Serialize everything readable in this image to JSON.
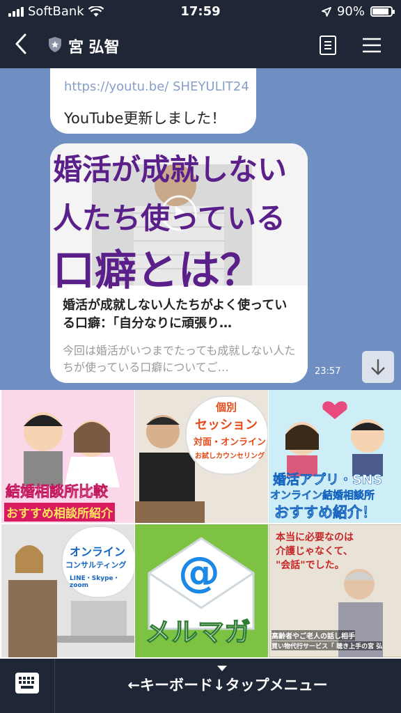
{
  "status": {
    "carrier": "SoftBank",
    "time": "17:59",
    "battery": "90%",
    "battery_level": 0.9
  },
  "header": {
    "title": "宮 弘智"
  },
  "chat": {
    "prev_message_url": "https://youtu.be/ SHEYULIT24",
    "prev_message_text": "YouTube更新しました！",
    "card": {
      "thumb_line1": "婚活が成就しない",
      "thumb_line2": "人たち使っている",
      "thumb_line3": "口癖とは？",
      "title": "婚活が成就しない人たちがよく使っている口癖：「自分なりに頑張り…",
      "description": "今回は婚活がいつまでたっても成就しない人たちが使っている口癖についてご…"
    },
    "timestamp": "23:57"
  },
  "rich_menu": {
    "tiles": [
      {
        "line1": "結婚相談所比較",
        "line2": "おすすめ相談所紹介"
      },
      {
        "line1": "個別",
        "line2": "セッション",
        "line3": "対面・オンライン",
        "line4": "お試しカウンセリング"
      },
      {
        "line1": "婚活アプリ・SNS",
        "line2": "オンライン結婚相談所",
        "line3": "おすすめ紹介！"
      },
      {
        "line1": "オンライン",
        "line2": "コンサルティング",
        "line3": "LINE・Skype・zoom"
      },
      {
        "line1": "@",
        "line2": "メルマガ"
      },
      {
        "line1": "本当に必要なのは",
        "line2": "介護じゃなくて、",
        "line3": "\"会話\"でした。",
        "line4": "高齢者やご老人の話し相手",
        "line5": "買い物代行サービス「 聴き上手の宮 弘"
      }
    ]
  },
  "bottom": {
    "label": "←キーボード↓タップメニュー"
  }
}
